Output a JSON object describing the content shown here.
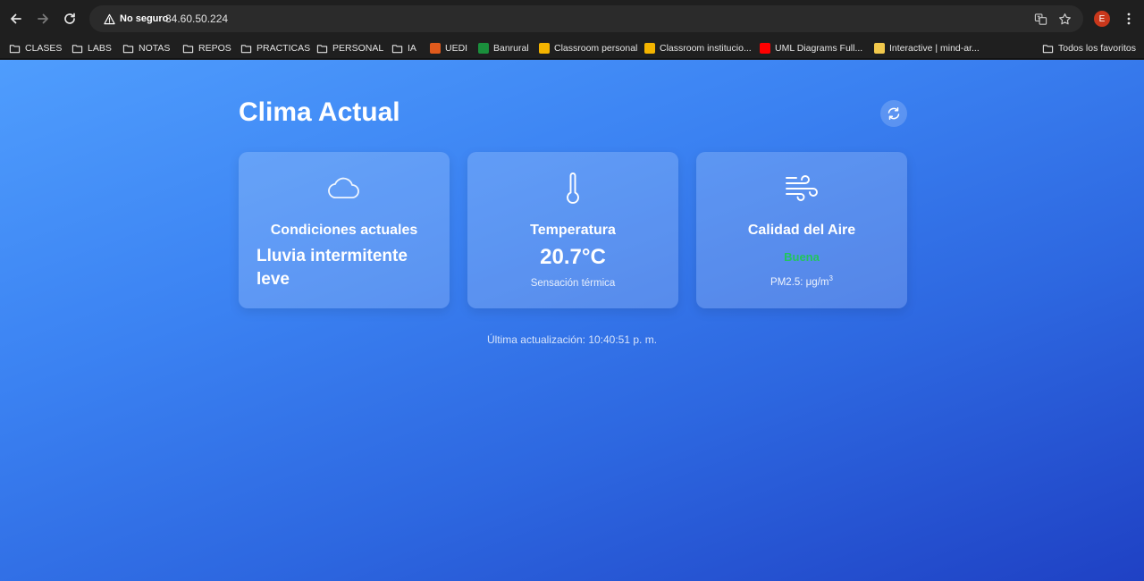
{
  "browser": {
    "security_label": "No seguro",
    "url": "34.60.50.224",
    "profile_initial": "E",
    "bookmarks": [
      {
        "label": "CLASES",
        "icon": "folder-icon"
      },
      {
        "label": "LABS",
        "icon": "folder-icon"
      },
      {
        "label": "NOTAS",
        "icon": "folder-icon"
      },
      {
        "label": "REPOS",
        "icon": "folder-icon"
      },
      {
        "label": "PRACTICAS",
        "icon": "folder-icon"
      },
      {
        "label": "PERSONAL",
        "icon": "folder-icon"
      },
      {
        "label": "IA",
        "icon": "folder-icon"
      },
      {
        "label": "UEDI",
        "icon": "site-favicon",
        "color": "#e05a1c"
      },
      {
        "label": "Banrural",
        "icon": "site-favicon",
        "color": "#1a8f3c"
      },
      {
        "label": "Classroom personal",
        "icon": "classroom-favicon",
        "color": "#f4b400"
      },
      {
        "label": "Classroom institucio...",
        "icon": "classroom-favicon",
        "color": "#f4b400"
      },
      {
        "label": "UML Diagrams Full...",
        "icon": "youtube-favicon",
        "color": "#ff0000"
      },
      {
        "label": "Interactive | mind-ar...",
        "icon": "ar-favicon",
        "color": "#f2c94c"
      }
    ],
    "all_bookmarks_label": "Todos los favoritos"
  },
  "page": {
    "title": "Clima Actual",
    "cards": {
      "conditions": {
        "title": "Condiciones actuales",
        "value": "Lluvia intermitente leve",
        "icon": "cloud-icon"
      },
      "temperature": {
        "title": "Temperatura",
        "value": "20.7°C",
        "subtitle": "Sensación térmica",
        "icon": "thermometer-icon"
      },
      "air_quality": {
        "title": "Calidad del Aire",
        "status": "Buena",
        "status_color": "#22c55e",
        "pm_label": "PM2.5: μg/m",
        "pm_unit_sup": "3",
        "icon": "wind-icon"
      }
    },
    "last_update": "Última actualización: 10:40:51 p. m."
  },
  "colors": {
    "background_gradient_start": "#4f9dfd",
    "background_gradient_end": "#1f41c4"
  }
}
